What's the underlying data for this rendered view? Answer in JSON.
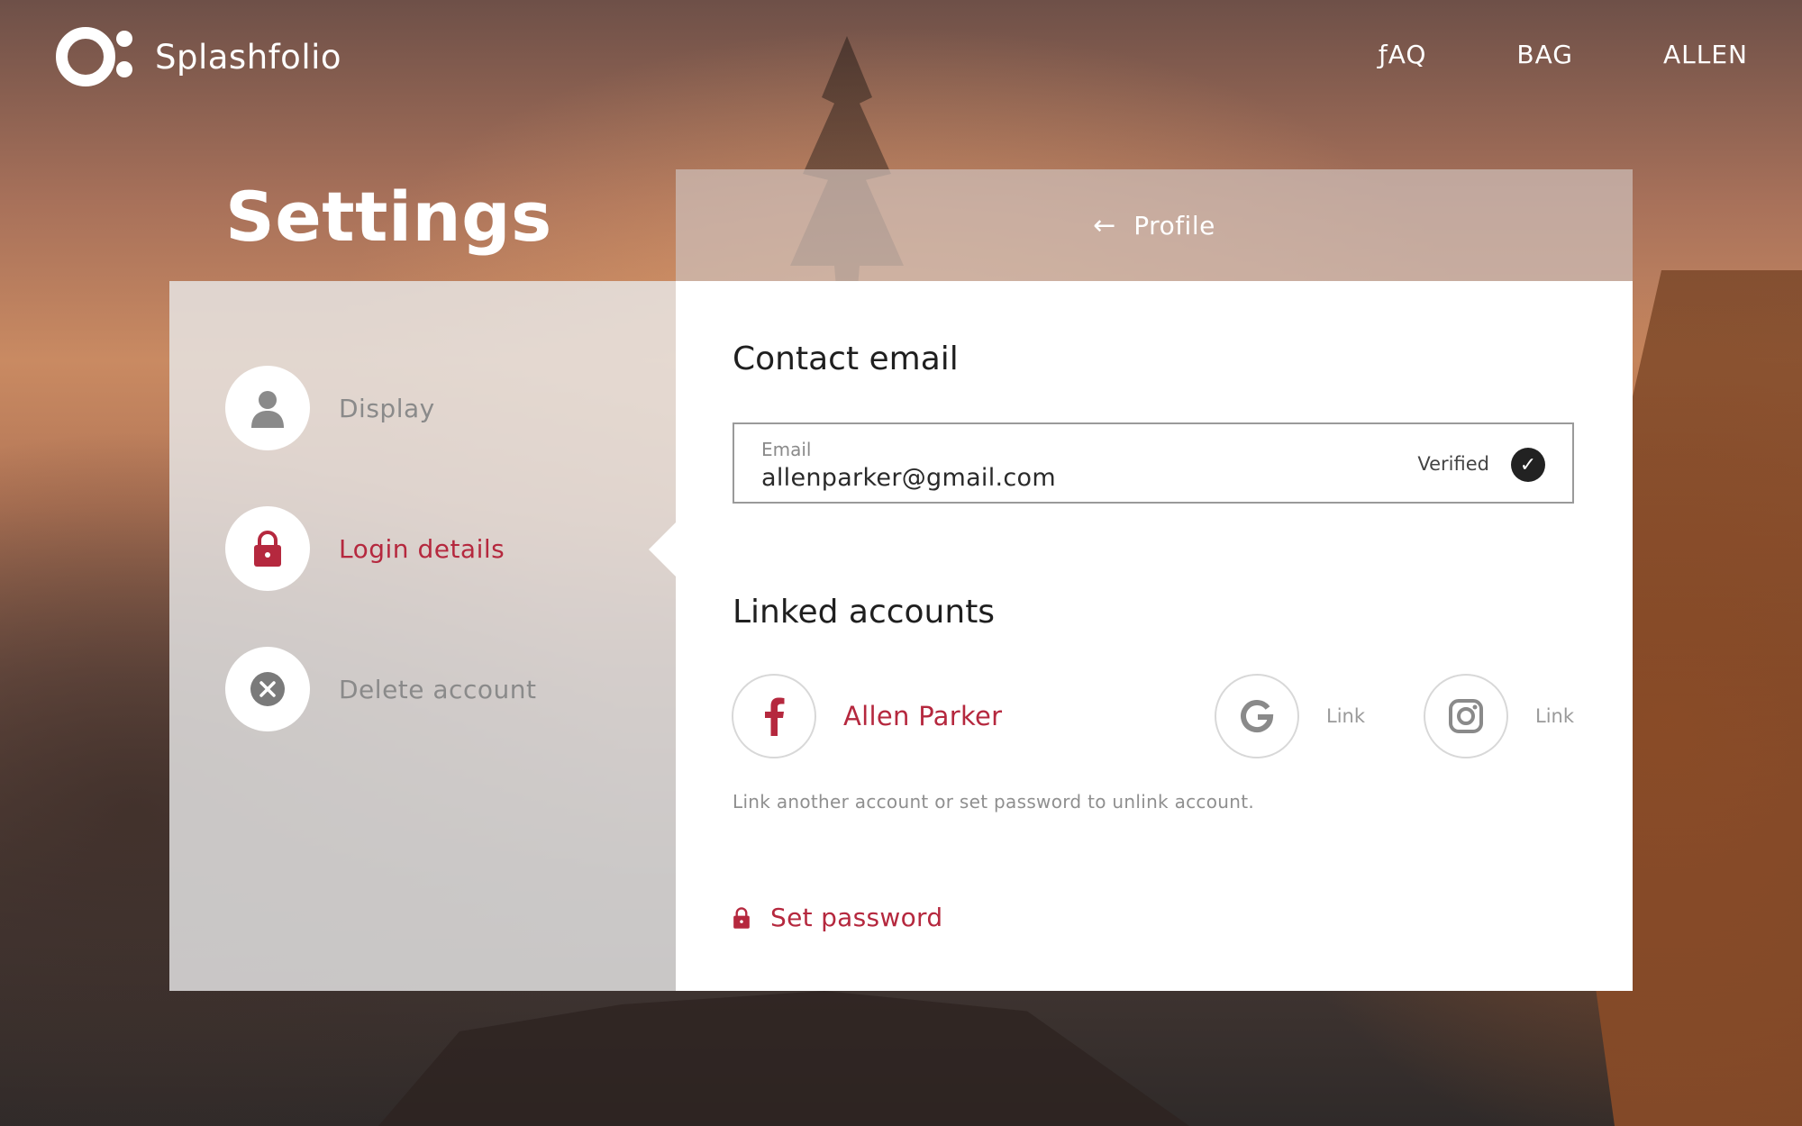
{
  "app": {
    "name": "Splashfolio"
  },
  "nav": {
    "items": [
      {
        "label": "ƒAQ"
      },
      {
        "label": "BAG"
      },
      {
        "label": "ALLEN"
      }
    ]
  },
  "page": {
    "title": "Settings"
  },
  "breadcrumb": {
    "back_icon": "arrow-left-icon",
    "label": "Profile"
  },
  "sidebar": {
    "items": [
      {
        "label": "Display",
        "icon": "user-icon",
        "active": false
      },
      {
        "label": "Login details",
        "icon": "lock-icon",
        "active": true
      },
      {
        "label": "Delete account",
        "icon": "close-circle-icon",
        "active": false
      }
    ]
  },
  "contact": {
    "title": "Contact email",
    "email_label": "Email",
    "email_value": "allenparker@gmail.com",
    "status": "Verified"
  },
  "linked": {
    "title": "Linked accounts",
    "accounts": [
      {
        "provider_icon": "facebook-icon",
        "text": "Allen Parker"
      },
      {
        "provider_icon": "google-icon",
        "text": "Link"
      },
      {
        "provider_icon": "instagram-icon",
        "text": "Link"
      }
    ],
    "hint": "Link another account or set password to unlink account."
  },
  "password": {
    "action_label": "Set password",
    "icon": "lock-icon"
  },
  "colors": {
    "accent": "#b5283e",
    "icon_gray": "#8a8a8a",
    "panel": "#ffffff"
  }
}
